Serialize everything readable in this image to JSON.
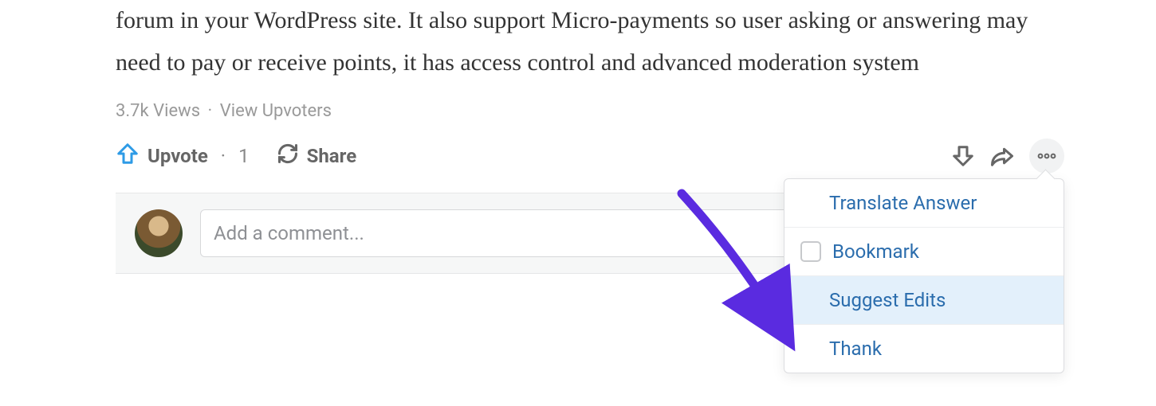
{
  "answer": {
    "text": "forum in your WordPress site. It also support Micro-payments so user asking or answering may need to pay or receive points, it has access control and advanced moderation system"
  },
  "meta": {
    "views": "3.7k Views",
    "dot": "·",
    "view_upvoters": "View Upvoters"
  },
  "actions": {
    "upvote_label": "Upvote",
    "upvote_sep": "·",
    "upvote_count": "1",
    "share_label": "Share"
  },
  "comment": {
    "placeholder": "Add a comment..."
  },
  "menu": {
    "items": [
      {
        "label": "Translate Answer",
        "checkbox": false,
        "highlight": false
      },
      {
        "label": "Bookmark",
        "checkbox": true,
        "highlight": false
      },
      {
        "label": "Suggest Edits",
        "checkbox": false,
        "highlight": true
      },
      {
        "label": "Thank",
        "checkbox": false,
        "highlight": false
      }
    ]
  },
  "colors": {
    "accent_blue": "#2b6dad",
    "upvote_blue": "#2e9be6",
    "arrow_purple": "#5a2be0"
  }
}
